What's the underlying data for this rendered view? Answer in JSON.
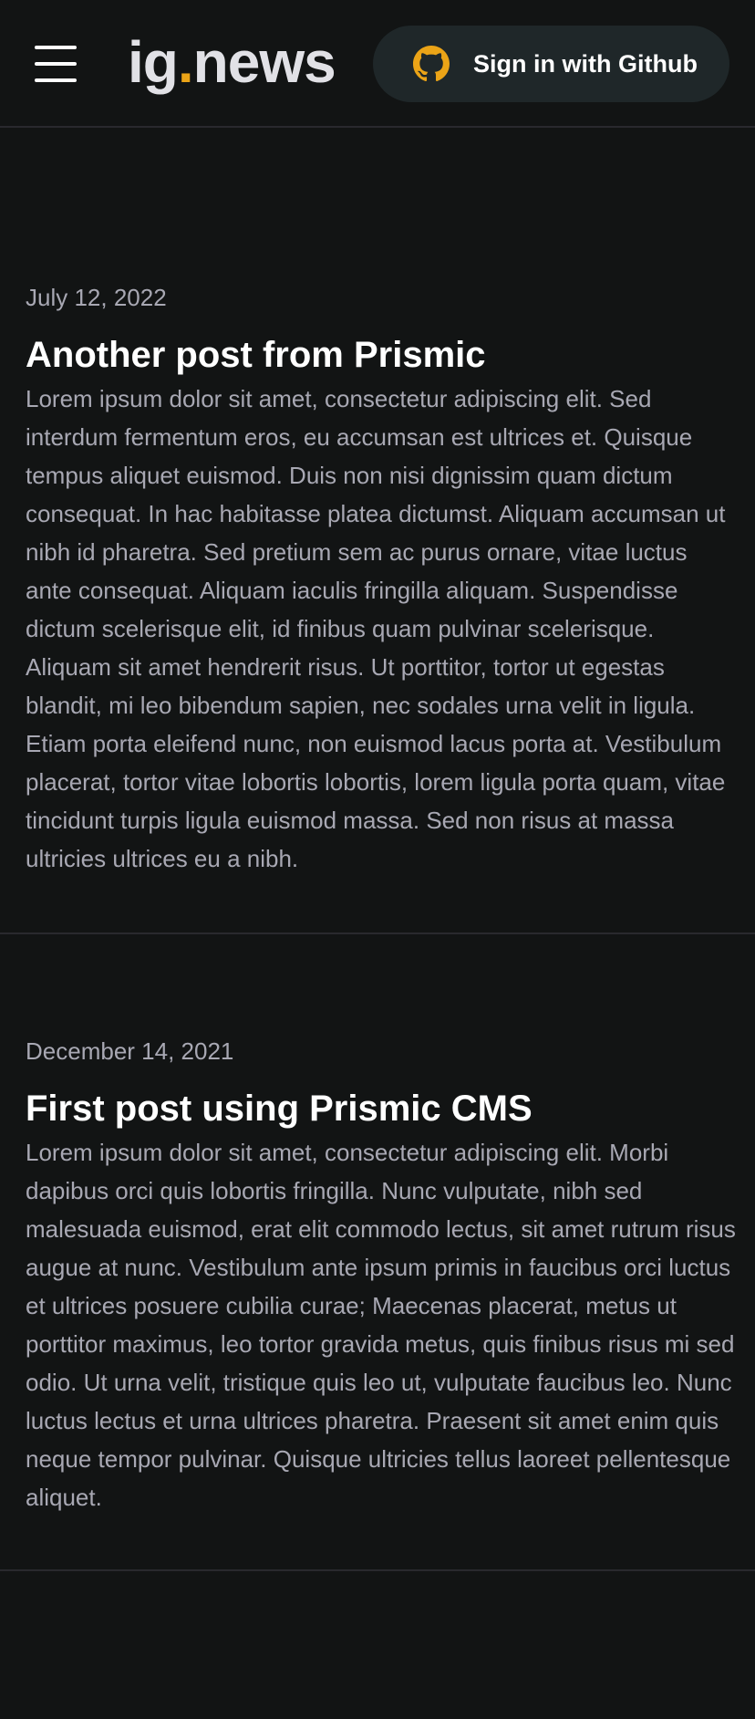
{
  "header": {
    "menu_icon": "hamburger-menu-icon",
    "logo_prefix": "ig",
    "logo_dot": ".",
    "logo_suffix": "news",
    "signin_label": "Sign in with Github",
    "signin_icon": "github-icon",
    "accent_color": "#eba417"
  },
  "posts": [
    {
      "date": "July 12, 2022",
      "title": "Another post from Prismic",
      "excerpt": "Lorem ipsum dolor sit amet, consectetur adipiscing elit. Sed interdum fermentum eros, eu accumsan est ultrices et. Quisque tempus aliquet euismod. Duis non nisi dignissim quam dictum consequat. In hac habitasse platea dictumst. Aliquam accumsan ut nibh id pharetra. Sed pretium sem ac purus ornare, vitae luctus ante consequat. Aliquam iaculis fringilla aliquam. Suspendisse dictum scelerisque elit, id finibus quam pulvinar scelerisque. Aliquam sit amet hendrerit risus. Ut porttitor, tortor ut egestas blandit, mi leo bibendum sapien, nec sodales urna velit in ligula. Etiam porta eleifend nunc, non euismod lacus porta at. Vestibulum placerat, tortor vitae lobortis lobortis, lorem ligula porta quam, vitae tincidunt turpis ligula euismod massa. Sed non risus at massa ultricies ultrices eu a nibh."
    },
    {
      "date": "December 14, 2021",
      "title": "First post using Prismic CMS",
      "excerpt": "Lorem ipsum dolor sit amet, consectetur adipiscing elit. Morbi dapibus orci quis lobortis fringilla. Nunc vulputate, nibh sed malesuada euismod, erat elit commodo lectus, sit amet rutrum risus augue at nunc. Vestibulum ante ipsum primis in faucibus orci luctus et ultrices posuere cubilia curae; Maecenas placerat, metus ut porttitor maximus, leo tortor gravida metus, quis finibus risus mi sed odio. Ut urna velit, tristique quis leo ut, vulputate faucibus leo. Nunc luctus lectus et urna ultrices pharetra. Praesent sit amet enim quis neque tempor pulvinar. Quisque ultricies tellus laoreet pellentesque aliquet."
    }
  ]
}
